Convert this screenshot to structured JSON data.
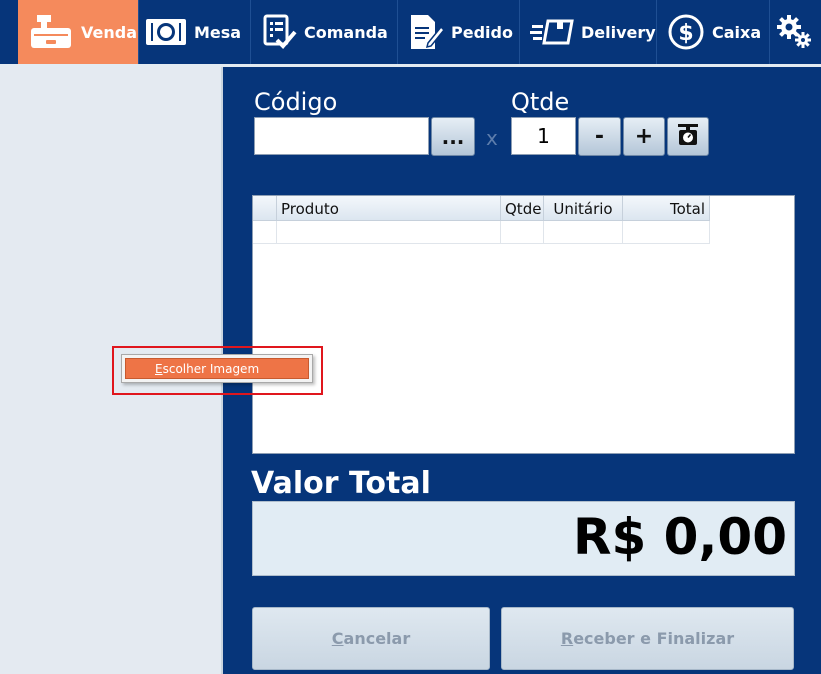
{
  "nav": {
    "items": [
      {
        "label": "Venda",
        "icon": "cash-register-icon"
      },
      {
        "label": "Mesa",
        "icon": "table-dish-icon"
      },
      {
        "label": "Comanda",
        "icon": "checklist-icon"
      },
      {
        "label": "Pedido",
        "icon": "document-edit-icon"
      },
      {
        "label": "Delivery",
        "icon": "fast-box-icon"
      },
      {
        "label": "Caixa",
        "icon": "dollar-coin-icon"
      }
    ],
    "settings_icon": "gears-icon",
    "active_color": "#f58a5c",
    "bar_color": "#06357a"
  },
  "form": {
    "codigo_label": "Código",
    "qtde_label": "Qtde",
    "x_label": "x",
    "codigo_value": "",
    "qtde_value": "1",
    "browse_label": "...",
    "minus_label": "-",
    "plus_label": "+",
    "scale_icon": "scale-icon"
  },
  "grid": {
    "columns": [
      "",
      "Produto",
      "Qtde",
      "Unitário",
      "Total"
    ],
    "rows": []
  },
  "context_menu": {
    "item_accel": "E",
    "item_rest": "scolher Imagem"
  },
  "total": {
    "label": "Valor Total",
    "value": "R$ 0,00"
  },
  "actions": {
    "cancel_accel": "C",
    "cancel_rest": "ancelar",
    "finish_accel": "R",
    "finish_rest": "eceber e Finalizar"
  }
}
